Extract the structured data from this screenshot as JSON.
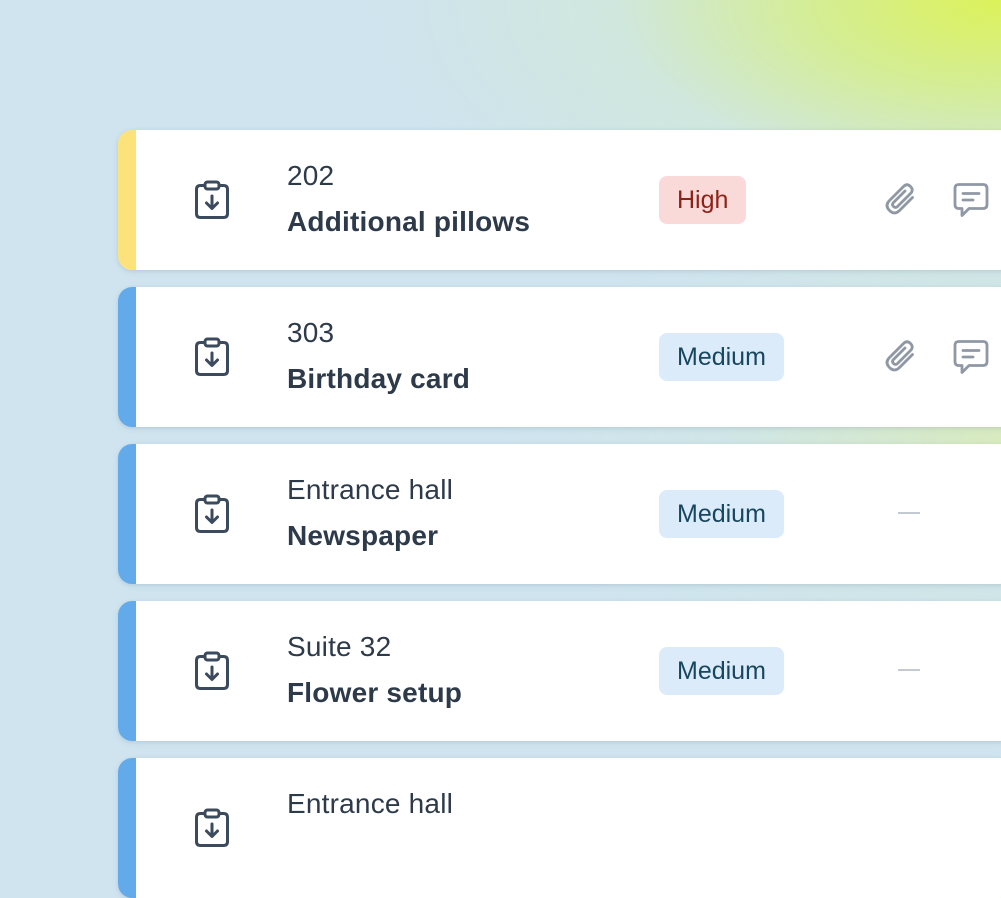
{
  "colors": {
    "high_stripe": "#fbe27a",
    "medium_stripe": "#62aaea",
    "high_badge_bg": "#fad9d9",
    "high_badge_text": "#8e2217",
    "medium_badge_bg": "#dcebf9",
    "medium_badge_text": "#17465f"
  },
  "tasks": [
    {
      "icon": "clipboard-download-icon",
      "location": "202",
      "title": "Additional pillows",
      "priority": "High",
      "has_attachment": true,
      "has_comment": true
    },
    {
      "icon": "clipboard-download-icon",
      "location": "303",
      "title": "Birthday card",
      "priority": "Medium",
      "has_attachment": true,
      "has_comment": true
    },
    {
      "icon": "clipboard-download-icon",
      "location": "Entrance hall",
      "title": "Newspaper",
      "priority": "Medium",
      "has_attachment": false,
      "has_comment": false,
      "empty_indicator": "–"
    },
    {
      "icon": "clipboard-download-icon",
      "location": "Suite 32",
      "title": "Flower setup",
      "priority": "Medium",
      "has_attachment": false,
      "has_comment": false,
      "empty_indicator": "–"
    },
    {
      "icon": "clipboard-download-icon",
      "location": "Entrance hall",
      "title": "",
      "priority": "",
      "has_attachment": false,
      "has_comment": false
    }
  ]
}
